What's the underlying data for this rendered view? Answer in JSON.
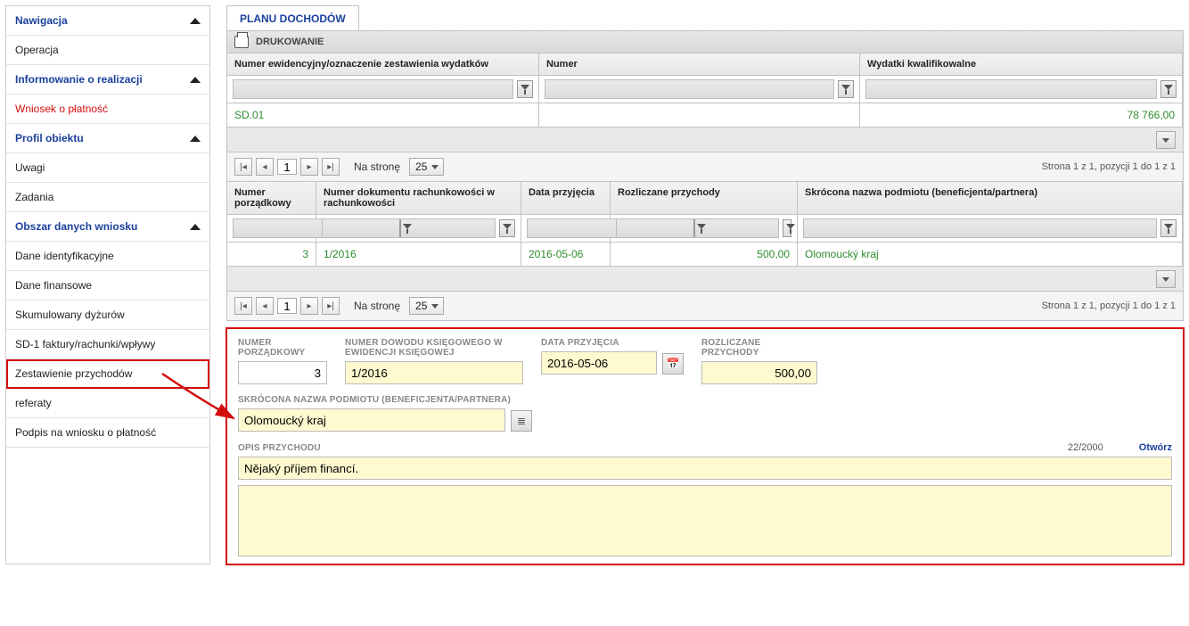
{
  "nav": {
    "section1": "Nawigacja",
    "op": "Operacja",
    "section2": "Informowanie o realizacji",
    "wniosek": "Wniosek o płatność",
    "section3": "Profil obiektu",
    "uwagi": "Uwagi",
    "zadania": "Zadania",
    "section4": "Obszar danych wniosku",
    "items": [
      "Dane identyfikacyjne",
      "Dane finansowe",
      "Skumulowany dyżurów",
      "SD-1 faktury/rachunki/wpływy",
      "Zestawienie przychodów",
      "referaty",
      "Podpis na wniosku o płatność"
    ]
  },
  "tab_title": "PLANU DOCHODÓW",
  "toolbar_print": "DRUKOWANIE",
  "grid1": {
    "cols": [
      "Numer ewidencyjny/oznaczenie zestawienia wydatków",
      "Numer",
      "Wydatki kwalifikowalne"
    ],
    "row": {
      "c0": "SD.01",
      "c1": "",
      "c2": "78 766,00"
    }
  },
  "grid2": {
    "cols": [
      "Numer porządkowy",
      "Numer dokumentu rachunkowości w rachunkowości",
      "Data przyjęcia",
      "Rozliczane przychody",
      "Skrócona nazwa podmiotu (beneficjenta/partnera)"
    ],
    "row": {
      "c0": "3",
      "c1": "1/2016",
      "c2": "2016-05-06",
      "c3": "500,00",
      "c4": "Olomoucký kraj"
    }
  },
  "pager": {
    "page": "1",
    "per_page_label": "Na stronę",
    "per_page": "25",
    "info": "Strona 1 z 1, pozycji 1 do 1 z 1"
  },
  "form": {
    "l_num": "NUMER PORZĄDKOWY",
    "v_num": "3",
    "l_doc": "NUMER DOWODU KSIĘGOWEGO W EWIDENCJI KSIĘGOWEJ",
    "v_doc": "1/2016",
    "l_date": "DATA PRZYJĘCIA",
    "v_date": "2016-05-06",
    "l_income": "ROZLICZANE PRZYCHODY",
    "v_income": "500,00",
    "l_subj": "SKRÓCONA NAZWA PODMIOTU (BENEFICJENTA/PARTNERA)",
    "v_subj": "Olomoucký kraj",
    "l_desc": "OPIS PRZYCHODU",
    "count": "22/2000",
    "open": "Otwórz",
    "v_desc": "Nějaký příjem financí."
  }
}
